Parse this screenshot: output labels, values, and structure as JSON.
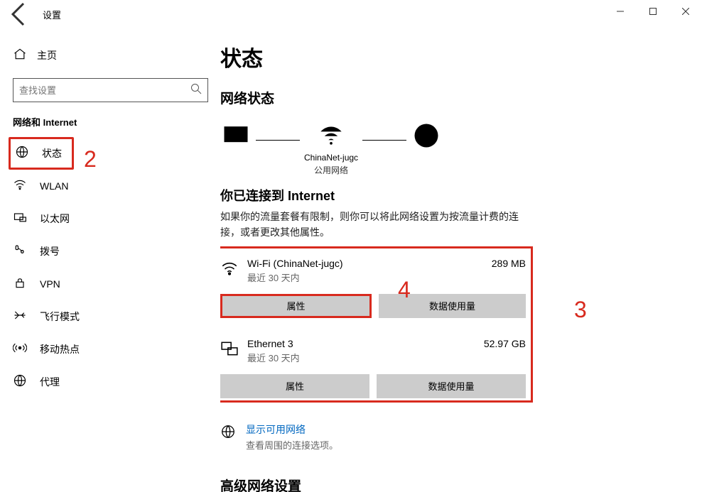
{
  "titlebar": {
    "title": "设置"
  },
  "sidebar": {
    "home_label": "主页",
    "search_placeholder": "查找设置",
    "category": "网络和 Internet",
    "items": [
      {
        "icon": "status",
        "label": "状态",
        "selected": true
      },
      {
        "icon": "wlan",
        "label": "WLAN"
      },
      {
        "icon": "ethernet",
        "label": "以太网"
      },
      {
        "icon": "dialup",
        "label": "拨号"
      },
      {
        "icon": "vpn",
        "label": "VPN"
      },
      {
        "icon": "airplane",
        "label": "飞行模式"
      },
      {
        "icon": "hotspot",
        "label": "移动热点"
      },
      {
        "icon": "proxy",
        "label": "代理"
      }
    ]
  },
  "content": {
    "page_title": "状态",
    "network_status_title": "网络状态",
    "diagram": {
      "wifi_name": "ChinaNet-jugc",
      "wifi_type": "公用网络"
    },
    "connected_title": "你已连接到 Internet",
    "connected_desc": "如果你的流量套餐有限制，则你可以将此网络设置为按流量计费的连接，或者更改其他属性。",
    "networks": [
      {
        "name": "Wi-Fi (ChinaNet-jugc)",
        "sub": "最近 30 天内",
        "usage": "289 MB",
        "properties_label": "属性",
        "data_usage_label": "数据使用量",
        "icon": "wifi"
      },
      {
        "name": "Ethernet 3",
        "sub": "最近 30 天内",
        "usage": "52.97 GB",
        "properties_label": "属性",
        "data_usage_label": "数据使用量",
        "icon": "ethernet"
      }
    ],
    "show_networks": {
      "title": "显示可用网络",
      "sub": "查看周围的连接选项。"
    },
    "advanced_title": "高级网络设置"
  },
  "annotations": {
    "a2": "2",
    "a3": "3",
    "a4": "4"
  }
}
